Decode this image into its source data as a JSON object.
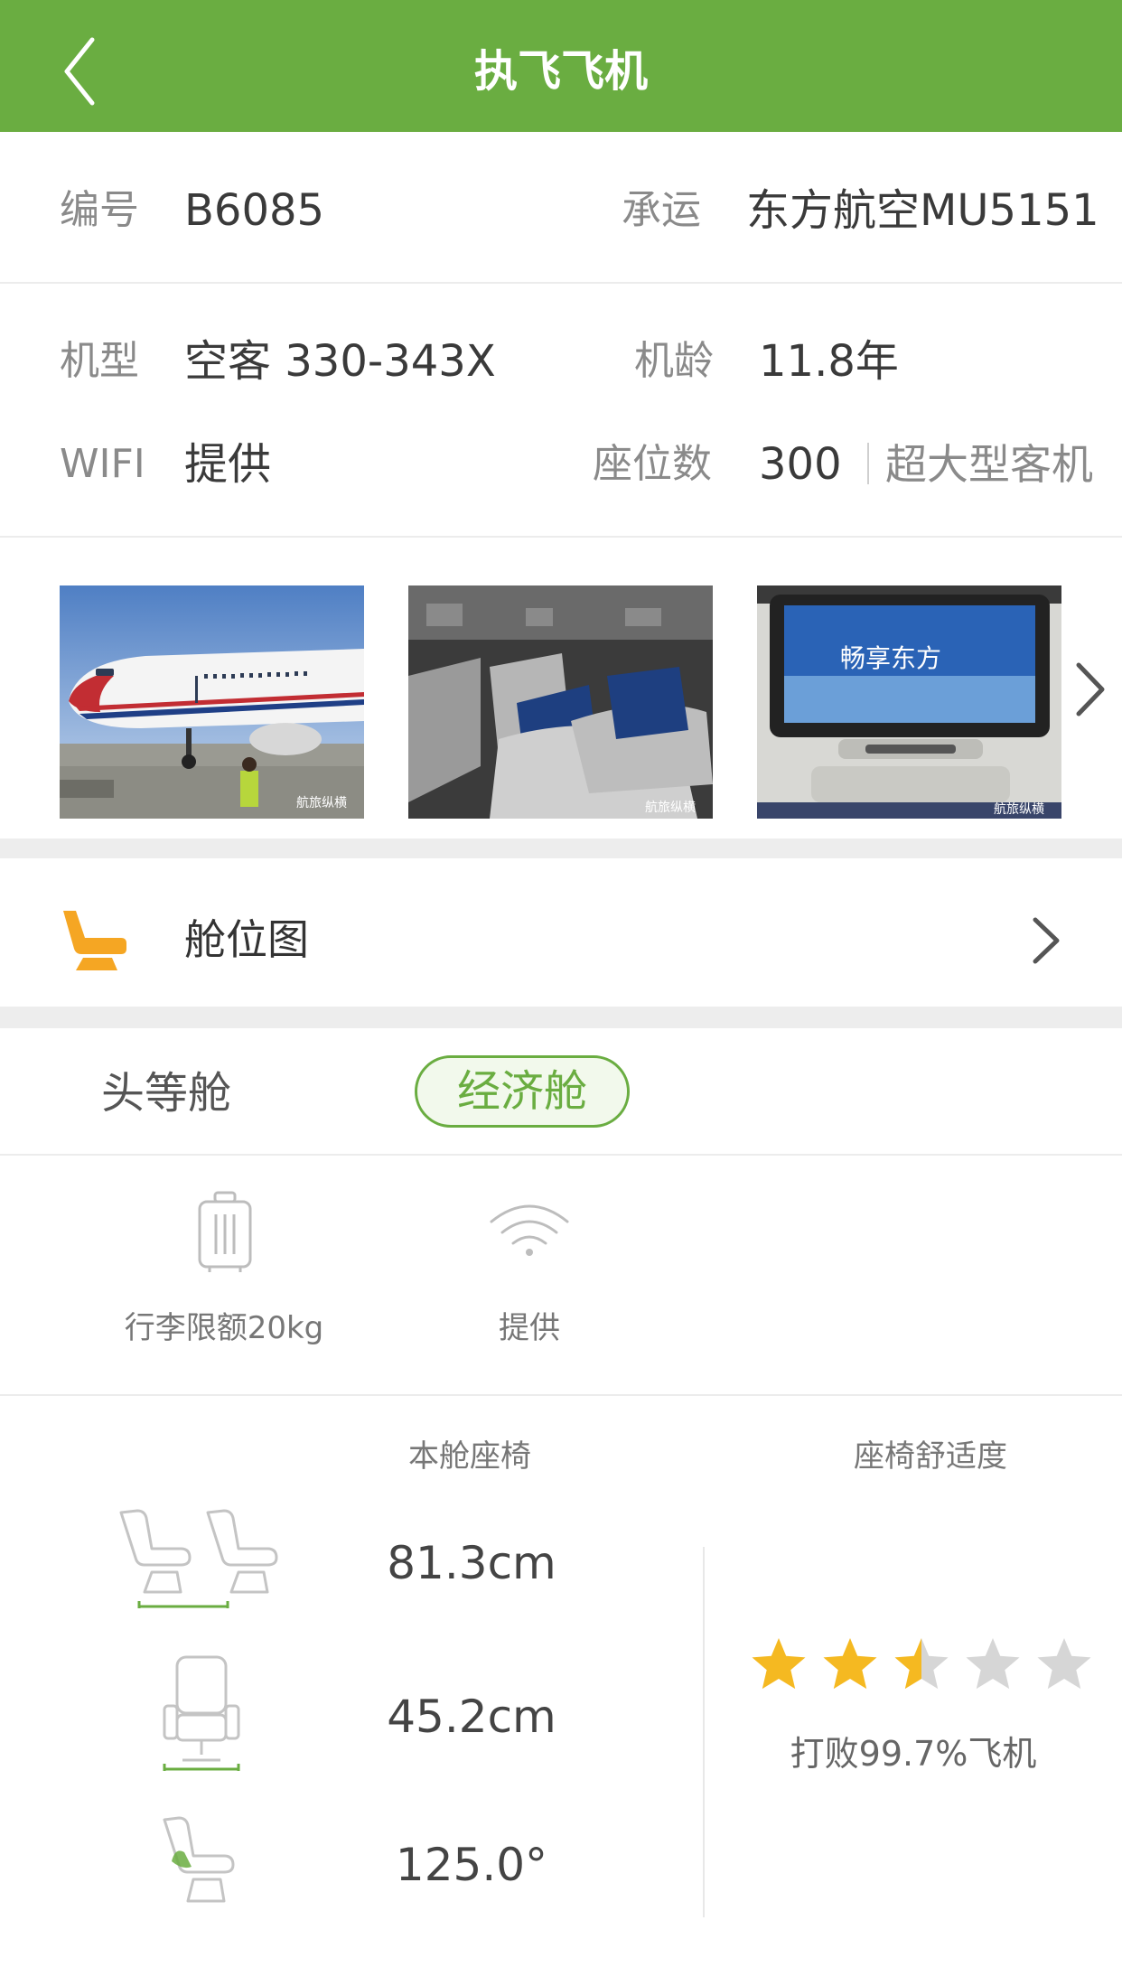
{
  "header": {
    "title": "执飞飞机"
  },
  "info": {
    "number_label": "编号",
    "number_value": "B6085",
    "carrier_label": "承运",
    "carrier_value": "东方航空MU5151",
    "model_label": "机型",
    "model_value": "空客 330-343X",
    "age_label": "机龄",
    "age_value": "11.8年",
    "wifi_label": "WIFI",
    "wifi_value": "提供",
    "seats_label": "座位数",
    "seats_value": "300",
    "aircraft_class": "超大型客机"
  },
  "photos": [
    {
      "name": "aircraft-exterior-photo",
      "watermark": "航旅纵横"
    },
    {
      "name": "cabin-seats-photo",
      "watermark": "航旅纵横"
    },
    {
      "name": "entertainment-screen-photo",
      "screen_text": "畅享东方",
      "watermark": "航旅纵横"
    }
  ],
  "seat_map": {
    "label": "舱位图"
  },
  "tabs": {
    "first": "头等舱",
    "economy": "经济舱",
    "selected": "economy"
  },
  "amenities": {
    "baggage": "行李限额20kg",
    "wifi": "提供"
  },
  "seat_specs": {
    "seat_header": "本舱座椅",
    "comfort_header": "座椅舒适度",
    "pitch": "81.3cm",
    "width": "45.2cm",
    "recline": "125.0°",
    "rating": 2.5,
    "rating_max": 5,
    "comfort_text": "打败99.7%飞机"
  },
  "colors": {
    "brand_green": "#6aad41",
    "star_gold": "#f5b921",
    "star_gray": "#d6d6d6",
    "seat_orange": "#f5a623"
  }
}
